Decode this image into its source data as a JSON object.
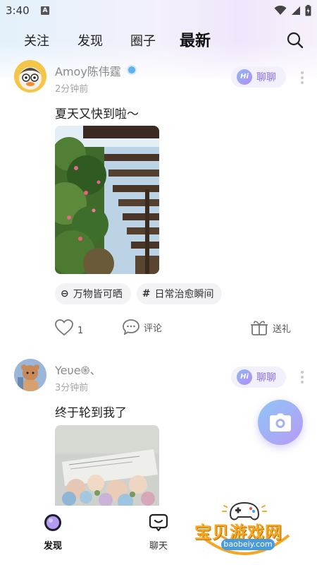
{
  "status": {
    "time": "3:40",
    "notification_icon": "A"
  },
  "top_tabs": [
    {
      "label": "关注",
      "active": false
    },
    {
      "label": "发现",
      "active": false
    },
    {
      "label": "圈子",
      "active": false
    },
    {
      "label": "最新",
      "active": true
    }
  ],
  "posts": [
    {
      "username": "Amoy陈伟霆",
      "time": "2分钟前",
      "chat_label": "聊聊",
      "hi_badge": "Hi",
      "text": "夏天又快到啦～",
      "tags": [
        {
          "icon": "⊖",
          "label": "万物皆可晒"
        },
        {
          "icon": "#",
          "label": "日常治愈瞬间"
        }
      ],
      "likes": "1",
      "comment_label": "评论",
      "gift_label": "送礼"
    },
    {
      "username": "Yeυe֍、",
      "time": "3分钟前",
      "chat_label": "聊聊",
      "hi_badge": "Hi",
      "text": "终于轮到我了"
    }
  ],
  "bottom_nav": [
    {
      "label": "发现",
      "active": true,
      "icon": "planet-icon"
    },
    {
      "label": "聊天",
      "active": false,
      "icon": "chat-bubble-icon"
    }
  ],
  "watermark": {
    "title": "宝贝游戏网",
    "url": "baobeiy.com"
  },
  "colors": {
    "accent": "#8b6fde",
    "verified": "#5fb2ef",
    "fab": "#a9b3f5"
  }
}
